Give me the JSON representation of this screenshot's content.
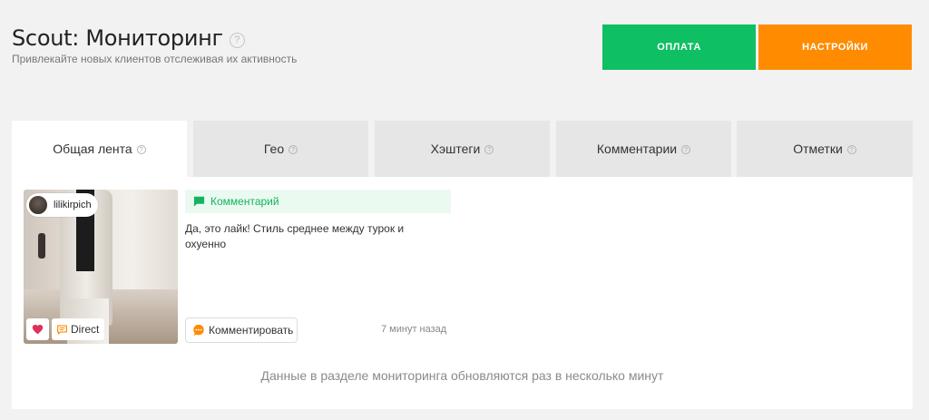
{
  "header": {
    "title": "Scout: Мониторинг",
    "help_icon": "?",
    "subtitle": "Привлекайте новых клиентов отслеживая их активность"
  },
  "buttons": {
    "pay_label": "ОПЛАТА",
    "settings_label": "НАСТРОЙКИ"
  },
  "colors": {
    "pay": "#0fbf63",
    "settings": "#ff8b00",
    "accent_green": "#14b360",
    "like_red": "#e0305a",
    "orange_icon": "#ff8b00"
  },
  "tabs": [
    {
      "label": "Общая лента",
      "help": "?",
      "active": true
    },
    {
      "label": "Гео",
      "help": "?",
      "active": false
    },
    {
      "label": "Хэштеги",
      "help": "?",
      "active": false
    },
    {
      "label": "Комментарии",
      "help": "?",
      "active": false
    },
    {
      "label": "Отметки",
      "help": "?",
      "active": false
    }
  ],
  "feed": {
    "item": {
      "username": "lilikirpich",
      "type_label": "Комментарий",
      "text": "Да, это лайк! Стиль среднее между турок и охуенно",
      "direct_label": "Direct",
      "reply_label": "Комментировать",
      "time": "7 минут назад",
      "icons": {
        "like": "heart-icon",
        "direct": "chat-bubble-icon",
        "type": "comment-icon",
        "reply": "speech-bubble-icon"
      }
    },
    "footer_note": "Данные в разделе мониторинга обновляются раз в несколько минут"
  }
}
